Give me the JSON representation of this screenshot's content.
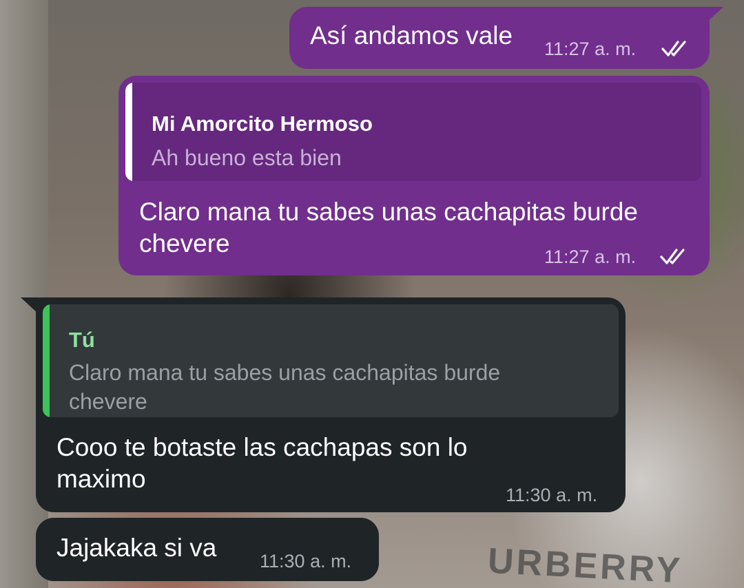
{
  "messages": [
    {
      "text": "Así andamos vale",
      "time": "11:27 a. m."
    },
    {
      "quote": {
        "author": "Mi Amorcito Hermoso",
        "text": "Ah bueno esta bien"
      },
      "text_lines": [
        "Claro mana tu sabes unas cachapitas burde",
        "chevere"
      ],
      "time": "11:27 a. m."
    },
    {
      "quote": {
        "author": "Tú",
        "text_lines": [
          "Claro mana tu sabes unas cachapitas burde",
          "chevere"
        ]
      },
      "text_lines": [
        "Cooo te botaste las cachapas son lo",
        "maximo"
      ],
      "time": "11:30 a. m."
    },
    {
      "text": "Jajakaka si va",
      "time": "11:30 a. m."
    }
  ],
  "background": {
    "shirt_text": "URBERRY"
  },
  "colors": {
    "outgoing_bubble": "#712e8d",
    "incoming_bubble": "#1f2427",
    "outgoing_quote_bg": "#65287e",
    "incoming_quote_bg": "#33383b",
    "quote_bar_outgoing": "#ffffff",
    "quote_bar_incoming": "#3ec35a",
    "quote_author_incoming": "#8fe0a0"
  },
  "icons": {
    "read_receipt": "double-check-icon"
  }
}
